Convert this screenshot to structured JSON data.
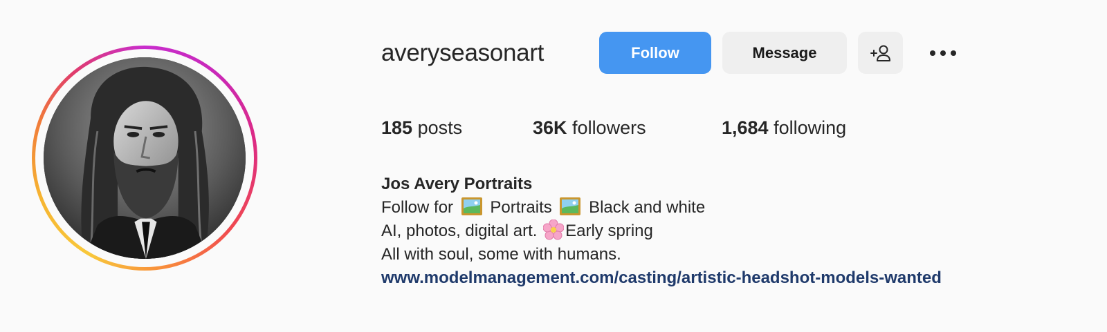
{
  "profile": {
    "username": "averyseasonart",
    "avatar_description_icon": "profile-photo"
  },
  "actions": {
    "follow_label": "Follow",
    "message_label": "Message",
    "suggest_icon": "add-person-icon",
    "more_icon": "more-horizontal-icon"
  },
  "stats": {
    "posts_count": "185",
    "posts_label": "posts",
    "followers_count": "36K",
    "followers_label": "followers",
    "following_count": "1,684",
    "following_label": "following"
  },
  "bio": {
    "display_name": "Jos Avery Portraits",
    "line1_prefix": "Follow for",
    "line1_mid": "Portraits",
    "line1_suffix": "Black and white",
    "line2_prefix": "AI, photos, digital art.",
    "line2_suffix": "Early spring",
    "line3": "All with soul, some with humans.",
    "link": "www.modelmanagement.com/casting/artistic-headshot-models-wanted"
  },
  "colors": {
    "follow_button": "#4596f1",
    "secondary_button": "#efefef",
    "link": "#1f3a6b",
    "background": "#fafafa"
  }
}
